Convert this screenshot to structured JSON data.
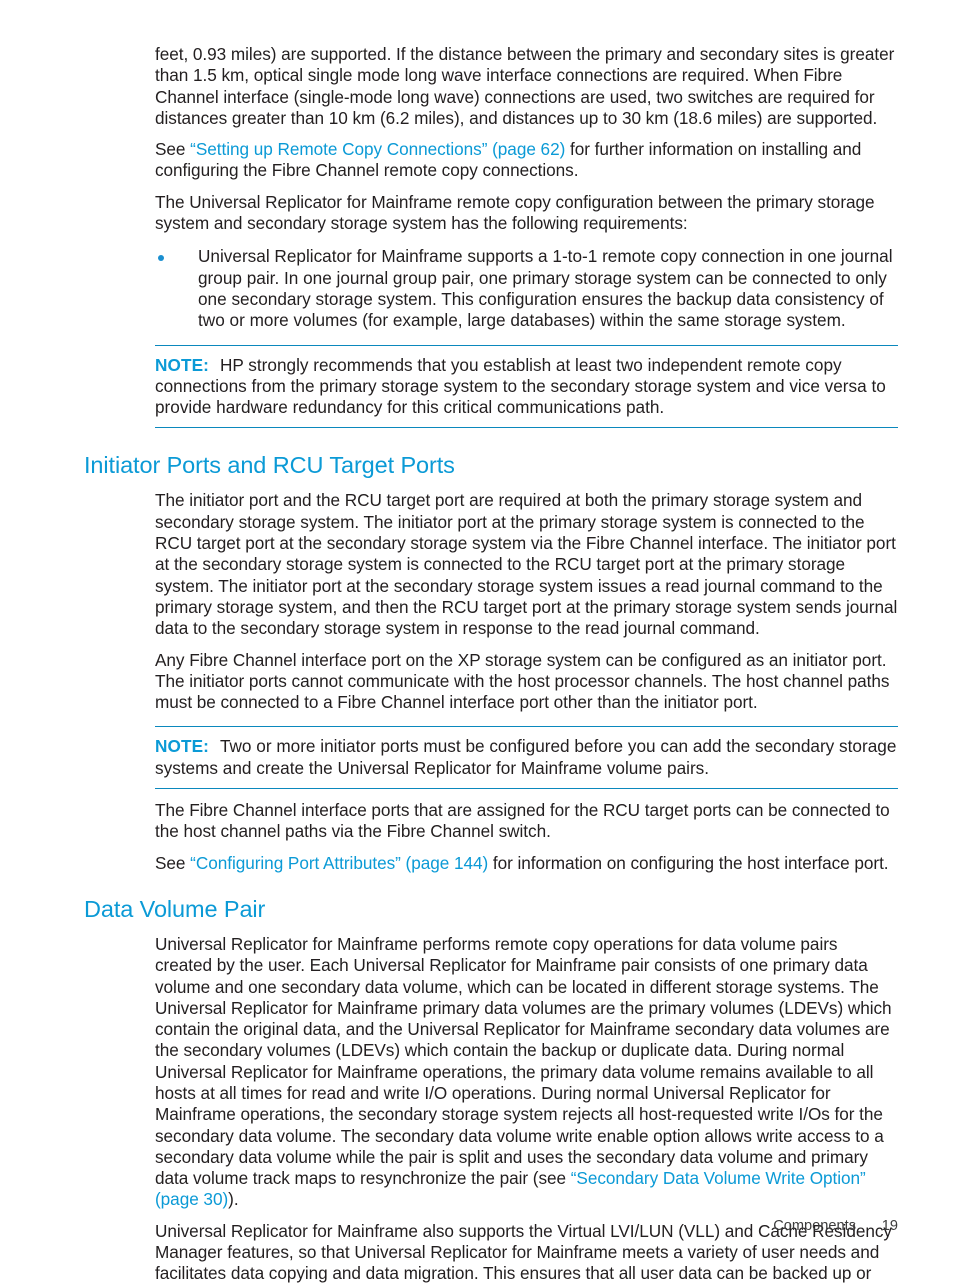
{
  "page": {
    "footer": {
      "chapter": "Components",
      "page_number": "19"
    },
    "colors": {
      "heading": "#0b9ad6",
      "link": "#0b9ad6",
      "note_rule": "#0b88bd",
      "bullet": "#1a8fd0",
      "body_text": "#231f20"
    }
  },
  "content": {
    "para_distance": {
      "text": "feet, 0.93 miles) are supported. If the distance between the primary and secondary sites is greater than 1.5 km, optical single mode long wave interface connections are required. When Fibre Channel interface (single-mode long wave) connections are used, two switches are required for distances greater than 10 km (6.2 miles), and distances up to 30 km (18.6 miles) are supported."
    },
    "para_see_remote_copy": {
      "prefix": "See ",
      "link": "“Setting up Remote Copy Connections” (page 62)",
      "suffix": " for further information on installing and configuring the Fibre Channel remote copy connections."
    },
    "para_requirements_intro": {
      "text": "The Universal Replicator for Mainframe remote copy configuration between the primary storage system and secondary storage system has the following requirements:"
    },
    "bullets": [
      {
        "text": "Universal Replicator for Mainframe supports a 1-to-1 remote copy connection in one journal group pair. In one journal group pair, one primary storage system can be connected to only one secondary storage system. This configuration ensures the backup data consistency of two or more volumes (for example, large databases) within the same storage system."
      }
    ],
    "note_1": {
      "label": "NOTE:",
      "text": "HP strongly recommends that you establish at least two independent remote copy connections from the primary storage system to the secondary storage system and vice versa to provide hardware redundancy for this critical communications path."
    },
    "heading_initiator_ports": "Initiator Ports and RCU Target Ports",
    "para_initiator_1": {
      "text": "The initiator port and the RCU target port are required at both the primary storage system and secondary storage system. The initiator port at the primary storage system is connected to the RCU target port at the secondary storage system via the Fibre Channel interface. The initiator port at the secondary storage system is connected to the RCU target port at the primary storage system. The initiator port at the secondary storage system issues a read journal command to the primary storage system, and then the RCU target port at the primary storage system sends journal data to the secondary storage system in response to the read journal command."
    },
    "para_initiator_2": {
      "text": "Any Fibre Channel interface port on the XP storage system can be configured as an initiator port. The initiator ports cannot communicate with the host processor channels. The host channel paths must be connected to a Fibre Channel interface port other than the initiator port."
    },
    "note_2": {
      "label": "NOTE:",
      "text": "Two or more initiator ports must be configured before you can add the secondary storage systems and create the Universal Replicator for Mainframe volume pairs."
    },
    "para_rcu_target": {
      "text": "The Fibre Channel interface ports that are assigned for the RCU target ports can be connected to the host channel paths via the Fibre Channel switch."
    },
    "para_see_port_attributes": {
      "prefix": "See ",
      "link": "“Configuring Port Attributes” (page 144)",
      "suffix": " for information on configuring the host interface port."
    },
    "heading_data_volume_pair": "Data Volume Pair",
    "para_dvp_1": {
      "prefix": "Universal Replicator for Mainframe performs remote copy operations for data volume pairs created by the user. Each Universal Replicator for Mainframe pair consists of one primary data volume and one secondary data volume, which can be located in different storage systems. The Universal Replicator for Mainframe primary data volumes are the primary volumes (LDEVs) which contain the original data, and the Universal Replicator for Mainframe secondary data volumes are the secondary volumes (LDEVs) which contain the backup or duplicate data. During normal Universal Replicator for Mainframe operations, the primary data volume remains available to all hosts at all times for read and write I/O operations. During normal Universal Replicator for Mainframe operations, the secondary storage system rejects all host-requested write I/Os for the secondary data volume. The secondary data volume write enable option allows write access to a secondary data volume while the pair is split and uses the secondary data volume and primary data volume track maps to resynchronize the pair (see ",
      "link": "“Secondary Data Volume Write Option” (page 30)",
      "suffix": ")."
    },
    "para_dvp_2": {
      "text": "Universal Replicator for Mainframe also supports the Virtual LVI/LUN (VLL) and Cache Residency Manager features, so that Universal Replicator for Mainframe meets a variety of user needs and facilitates data copying and data migration. This ensures that all user data can be backed up or"
    }
  }
}
